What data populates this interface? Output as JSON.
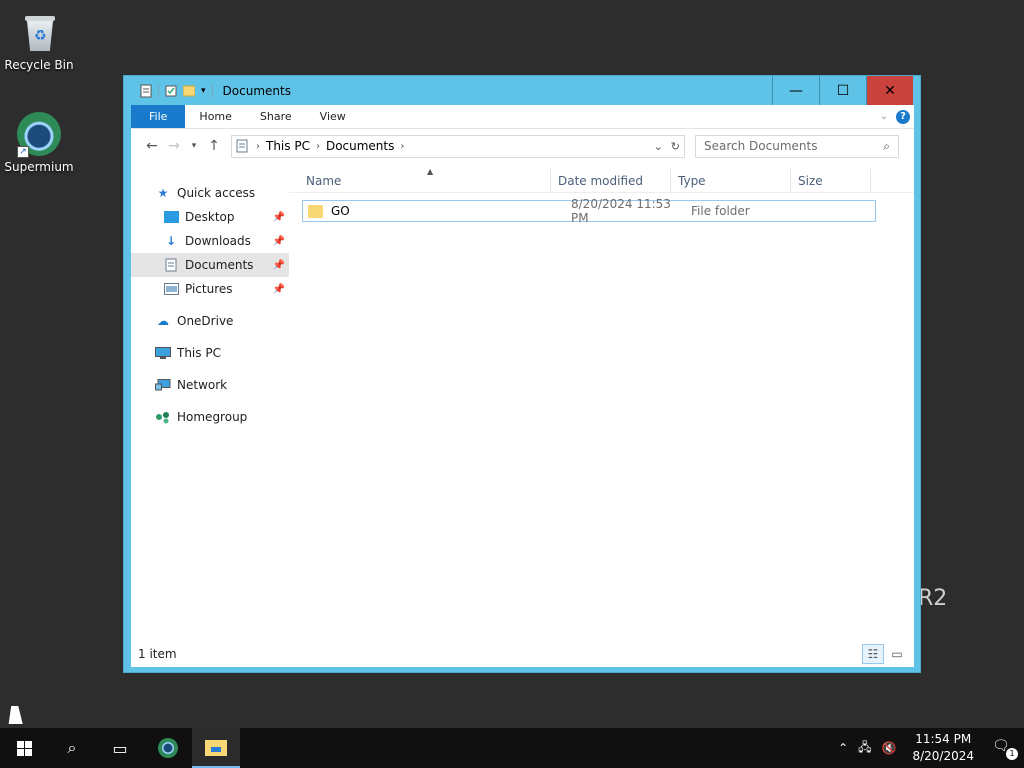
{
  "desktop": {
    "icons": [
      {
        "label": "Recycle Bin",
        "icon": "recycle-bin-icon"
      },
      {
        "label": "Supermium",
        "icon": "supermium-icon"
      }
    ],
    "watermark": "R2"
  },
  "window": {
    "title": "Documents",
    "controls": {
      "minimize": "—",
      "maximize": "☐",
      "close": "✕"
    },
    "ribbon": {
      "tabs": [
        "File",
        "Home",
        "Share",
        "View"
      ],
      "help": "?"
    },
    "address": {
      "crumbs": [
        "This PC",
        "Documents"
      ],
      "search_placeholder": "Search Documents"
    },
    "nav": {
      "quick_access": "Quick access",
      "pinned": [
        {
          "label": "Desktop",
          "icon": "desktop-folder-icon"
        },
        {
          "label": "Downloads",
          "icon": "downloads-folder-icon"
        },
        {
          "label": "Documents",
          "icon": "documents-folder-icon",
          "selected": true
        },
        {
          "label": "Pictures",
          "icon": "pictures-folder-icon"
        }
      ],
      "roots": [
        {
          "label": "OneDrive",
          "icon": "onedrive-icon"
        },
        {
          "label": "This PC",
          "icon": "this-pc-icon"
        },
        {
          "label": "Network",
          "icon": "network-icon"
        },
        {
          "label": "Homegroup",
          "icon": "homegroup-icon"
        }
      ]
    },
    "columns": [
      "Name",
      "Date modified",
      "Type",
      "Size"
    ],
    "files": [
      {
        "name": "GO",
        "date_modified": "8/20/2024 11:53 PM",
        "type": "File folder",
        "size": ""
      }
    ],
    "status": "1 item"
  },
  "taskbar": {
    "time": "11:54 PM",
    "date": "8/20/2024",
    "notification_count": "1"
  },
  "colors": {
    "accent": "#1979ca",
    "titlebar": "#5fc3e8",
    "close": "#c9423b"
  }
}
